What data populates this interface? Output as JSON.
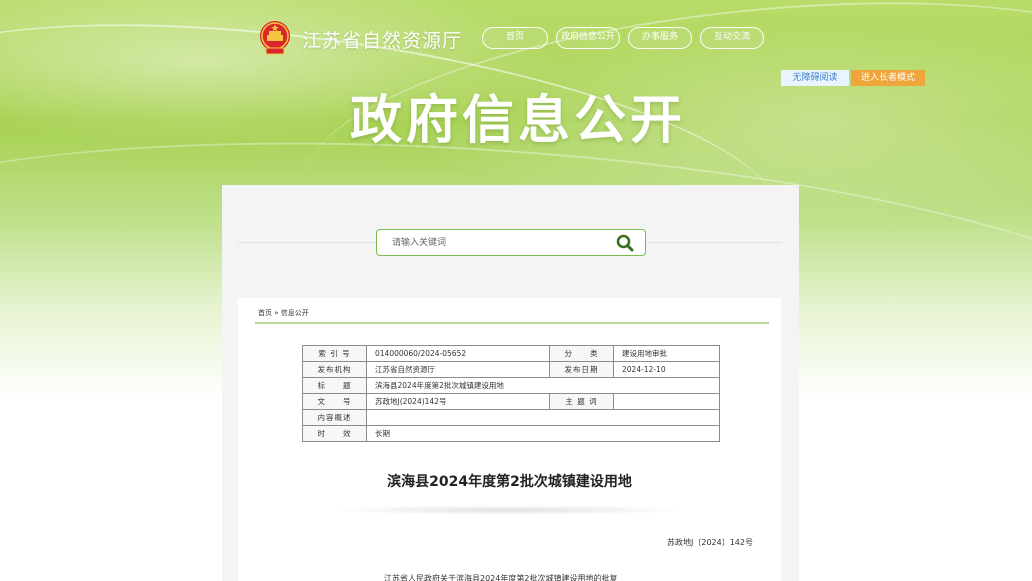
{
  "header": {
    "site_title": "江苏省自然资源厅",
    "nav": [
      "首页",
      "政府信息公开",
      "办事服务",
      "互动交流"
    ],
    "accessible_label": "无障碍阅读",
    "elder_mode_label": "进入长者模式",
    "banner_title": "政府信息公开"
  },
  "search": {
    "placeholder": "请输入关键词"
  },
  "breadcrumb": "首页 » 信息公开",
  "meta_table": {
    "rows": [
      {
        "label": "索 引 号",
        "value": "014000060/2024-05652",
        "label2": "分　　类",
        "value2": "建设用地审批"
      },
      {
        "label": "发布机构",
        "value": "江苏省自然资源厅",
        "label2": "发布日期",
        "value2": "2024-12-10"
      },
      {
        "label": "标　　题",
        "value": "滨海县2024年度第2批次城镇建设用地"
      },
      {
        "label": "文　　号",
        "value": "苏政地J(2024)142号",
        "label2": "主 题 词",
        "value2": ""
      },
      {
        "label": "内容概述",
        "value": ""
      },
      {
        "label": "时　　效",
        "value": "长期"
      }
    ]
  },
  "document": {
    "title": "滨海县2024年度第2批次城镇建设用地",
    "number": "苏政地J〔2024〕142号",
    "body_first_line": "江苏省人民政府关于滨海县2024年度第2批次城镇建设用地的批复"
  },
  "colors": {
    "green_accent": "#7cba4a",
    "elder_button": "#f0a53a",
    "accessible_text": "#3d7fd1"
  }
}
